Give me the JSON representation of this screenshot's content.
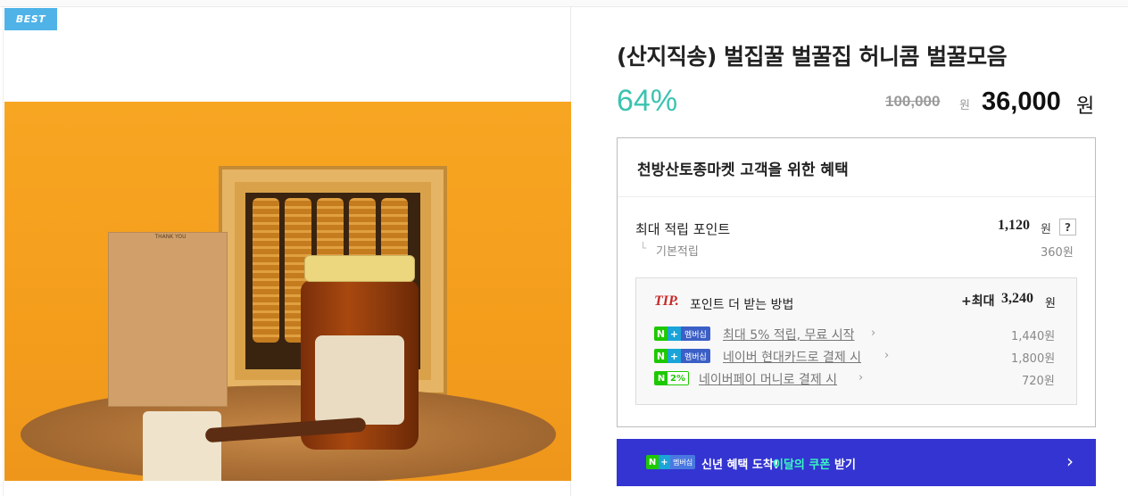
{
  "badge": {
    "label": "BEST"
  },
  "product": {
    "title": "(산지직송) 벌집꿀 벌꿀집 허니콤 벌꿀모음",
    "image_text": "THANK YOU",
    "discount": "64%",
    "original_price": "100,000",
    "original_unit": "원",
    "sale_price": "36,000",
    "sale_unit": "원"
  },
  "benefits": {
    "title": "천방산토종마켓 고객을 위한 혜택",
    "max_points_label": "최대 적립 포인트",
    "max_points_value": "1,120",
    "max_points_unit": "원",
    "help_label": "?",
    "sub_mark": "└",
    "basic_label": "기본적립",
    "basic_value": "360원",
    "tip": {
      "word": "TIP.",
      "label": "포인트 더 받는 방법",
      "max_prefix": "+최대",
      "max_value": "3,240",
      "max_unit": "원",
      "rows": [
        {
          "badge": "멤버십",
          "text": "최대 5% 적립, 무료 시작",
          "value": "1,440원"
        },
        {
          "badge": "멤버십",
          "text": "네이버 현대카드로 결제 시",
          "value": "1,800원"
        },
        {
          "badge": "2%",
          "text": "네이버페이 머니로 결제 시",
          "value": "720원"
        }
      ]
    }
  },
  "banner": {
    "badge": "멤버십",
    "text": "신년 혜택 도착!",
    "highlight": "이달의 쿠폰",
    "end": "받기",
    "chevron": "›"
  },
  "colors": {
    "accent_teal": "#3cc3b0",
    "banner_blue": "#3334d1",
    "naver_green": "#1ec800",
    "tip_red": "#c62828"
  }
}
